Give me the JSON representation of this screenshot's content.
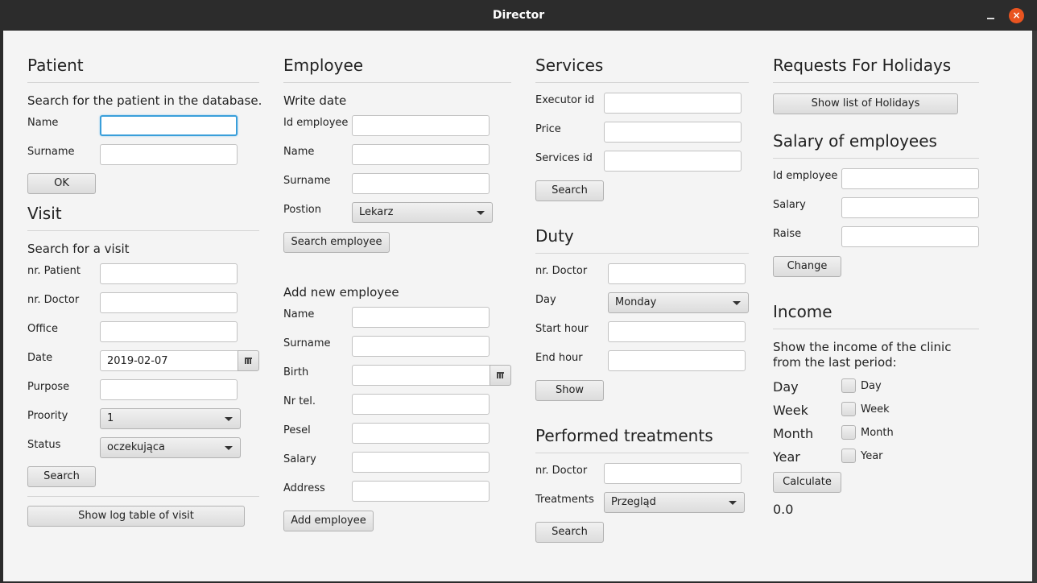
{
  "window": {
    "title": "Director",
    "minimize": "_",
    "close": "×"
  },
  "patient": {
    "heading": "Patient",
    "subtitle": "Search for the patient in the database.",
    "name_label": "Name",
    "surname_label": "Surname",
    "ok_label": "OK"
  },
  "visit": {
    "heading": "Visit",
    "subtitle": "Search for a visit",
    "patient_label": "nr. Patient",
    "doctor_label": "nr. Doctor",
    "office_label": "Office",
    "date_label": "Date",
    "date_value": "2019-02-07",
    "purpose_label": "Purpose",
    "priority_label": "Proority",
    "priority_value": "1",
    "status_label": "Status",
    "status_value": "oczekująca",
    "search_label": "Search",
    "log_label": "Show log table of visit"
  },
  "employee": {
    "heading": "Employee",
    "subtitle": "Write date",
    "id_label": "Id employee",
    "name_label": "Name",
    "surname_label": "Surname",
    "position_label": "Postion",
    "position_value": "Lekarz",
    "search_label": "Search employee"
  },
  "add_employee": {
    "subtitle": "Add new employee",
    "name_label": "Name",
    "surname_label": "Surname",
    "birth_label": "Birth",
    "phone_label": "Nr tel.",
    "pesel_label": "Pesel",
    "salary_label": "Salary",
    "address_label": "Address",
    "add_label": "Add employee"
  },
  "services": {
    "heading": "Services",
    "executor_label": "Executor id",
    "price_label": "Price",
    "services_id_label": "Services id",
    "search_label": "Search"
  },
  "duty": {
    "heading": "Duty",
    "doctor_label": "nr. Doctor",
    "day_label": "Day",
    "day_value": "Monday",
    "start_label": "Start hour",
    "end_label": "End hour",
    "show_label": "Show"
  },
  "treatments": {
    "heading": "Performed treatments",
    "doctor_label": "nr. Doctor",
    "treatments_label": "Treatments",
    "treatments_value": "Przegląd",
    "search_label": "Search"
  },
  "holidays": {
    "heading": "Requests For Holidays",
    "show_label": "Show list of Holidays"
  },
  "salary": {
    "heading": "Salary of employees",
    "id_label": "Id employee",
    "salary_label": "Salary",
    "raise_label": "Raise",
    "change_label": "Change"
  },
  "income": {
    "heading": "Income",
    "description": "Show the income of the clinic from the last period:",
    "day_label": "Day",
    "day_check": "Day",
    "week_label": "Week",
    "week_check": "Week",
    "month_label": "Month",
    "month_check": "Month",
    "year_label": "Year",
    "year_check": "Year",
    "calculate_label": "Calculate",
    "result": "0.0"
  }
}
